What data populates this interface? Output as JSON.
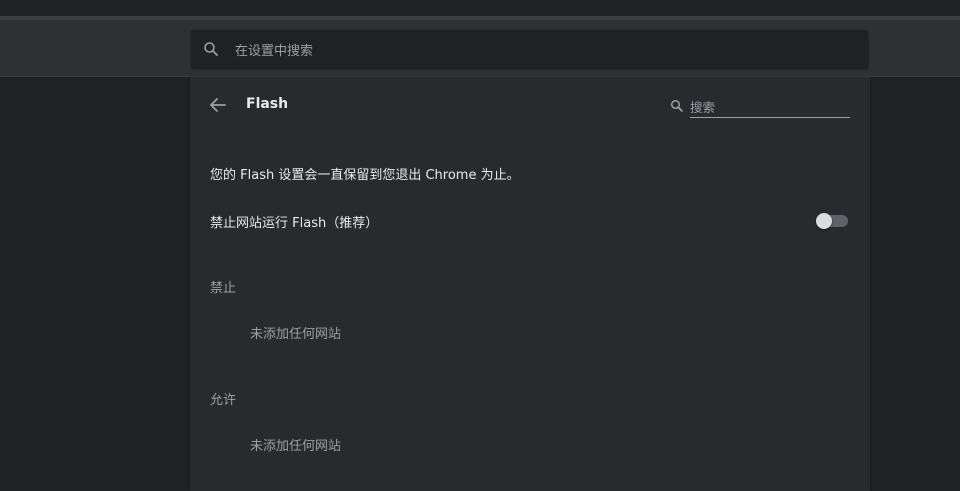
{
  "toolbar": {
    "search_placeholder": "在设置中搜索"
  },
  "page": {
    "title": "Flash",
    "search_placeholder": "搜索"
  },
  "content": {
    "notice": "您的 Flash 设置会一直保留到您退出 Chrome 为止。",
    "block_sites_label": "禁止网站运行 Flash（推荐）",
    "block_sites_toggle_on": false
  },
  "sections": {
    "blocked": {
      "header": "禁止",
      "empty_text": "未添加任何网站"
    },
    "allowed": {
      "header": "允许",
      "empty_text": "未添加任何网站"
    }
  },
  "icons": {
    "global_search": "search-icon",
    "back": "arrow-back-icon",
    "page_search": "search-icon"
  },
  "colors": {
    "background": "#202124",
    "card": "#292a2d",
    "toolbar": "#2f3033",
    "text_primary": "#e8eaed",
    "text_secondary": "#9aa0a6",
    "toggle_track_off": "#5f6368",
    "toggle_knob_off": "#dadce0"
  }
}
